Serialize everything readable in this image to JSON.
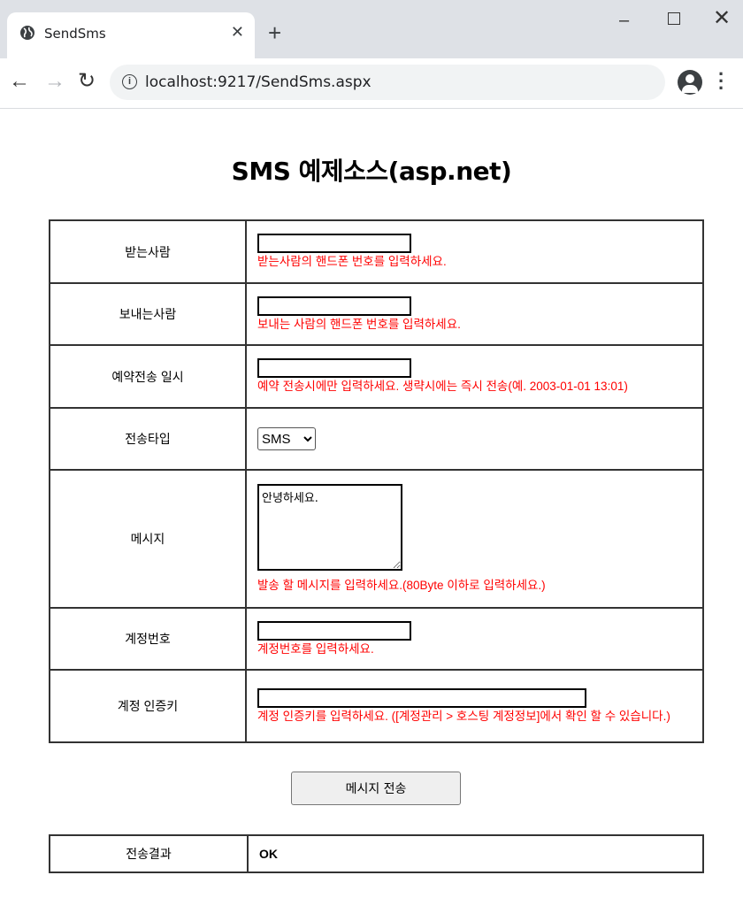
{
  "browser": {
    "tab_title": "SendSms",
    "new_tab": "+",
    "url": "localhost:9217/SendSms.aspx",
    "win_min": "–",
    "win_close": "✕"
  },
  "page": {
    "title": "SMS 예제소스(asp.net)"
  },
  "form": {
    "rows": [
      {
        "label": "받는사람",
        "hint": "받는사람의 핸드폰 번호를 입력하세요.",
        "value": ""
      },
      {
        "label": "보내는사람",
        "hint": "보내는 사람의 핸드폰 번호를 입력하세요.",
        "value": ""
      },
      {
        "label": "예약전송 일시",
        "hint": "예약 전송시에만 입력하세요. 생략시에는 즉시 전송(예. 2003-01-01 13:01)",
        "value": ""
      },
      {
        "label": "전송타입",
        "select_value": "SMS"
      },
      {
        "label": "메시지",
        "message": "안녕하세요.",
        "hint": "발송 할 메시지를 입력하세요.(80Byte 이하로 입력하세요.)"
      },
      {
        "label": "계정번호",
        "hint": "계정번호를 입력하세요.",
        "value": ""
      },
      {
        "label": "계정 인증키",
        "hint": "계정 인증키를 입력하세요. ([계정관리 > 호스팅 계정정보]에서 확인 할 수 있습니다.)",
        "value": ""
      }
    ],
    "send_button": "메시지 전송"
  },
  "result": {
    "label": "전송결과",
    "value": "OK"
  }
}
